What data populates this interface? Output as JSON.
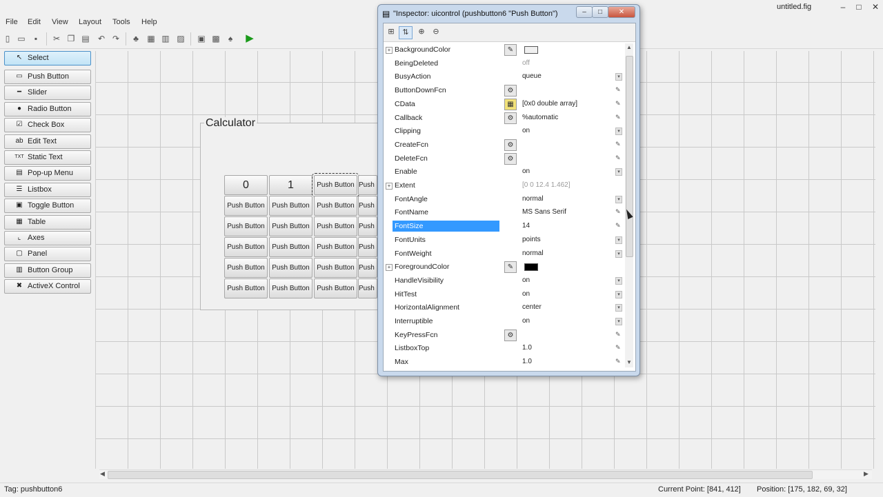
{
  "window": {
    "title": "untitled.fig",
    "controls": [
      "minimize-icon",
      "maximize-icon",
      "close-icon"
    ]
  },
  "menu": [
    "File",
    "Edit",
    "View",
    "Layout",
    "Tools",
    "Help"
  ],
  "palette": [
    {
      "label": "Select",
      "icon": "arrow-cursor-icon",
      "selected": true
    },
    {
      "label": "Push Button",
      "icon": "push-button-icon"
    },
    {
      "label": "Slider",
      "icon": "slider-icon"
    },
    {
      "label": "Radio Button",
      "icon": "radio-button-icon"
    },
    {
      "label": "Check Box",
      "icon": "check-box-icon"
    },
    {
      "label": "Edit Text",
      "icon": "edit-text-icon"
    },
    {
      "label": "Static Text",
      "icon": "static-text-icon"
    },
    {
      "label": "Pop-up Menu",
      "icon": "popup-menu-icon"
    },
    {
      "label": "Listbox",
      "icon": "listbox-icon"
    },
    {
      "label": "Toggle Button",
      "icon": "toggle-button-icon"
    },
    {
      "label": "Table",
      "icon": "table-icon"
    },
    {
      "label": "Axes",
      "icon": "axes-icon"
    },
    {
      "label": "Panel",
      "icon": "panel-icon"
    },
    {
      "label": "Button Group",
      "icon": "button-group-icon"
    },
    {
      "label": "ActiveX Control",
      "icon": "activex-icon"
    }
  ],
  "panel": {
    "title": "Calculator"
  },
  "buttons": {
    "row1": [
      "0",
      "1",
      "Push Button",
      "Push B"
    ],
    "default_label": "Push Button",
    "partial_label": "Push B"
  },
  "inspector": {
    "title": "\"Inspector:  uicontrol (pushbutton6 \"Push Button\")",
    "properties": [
      {
        "name": "BackgroundColor",
        "value": "",
        "expand": true,
        "editor": "color",
        "swatch": "#f0f0f0",
        "ctrl": "none"
      },
      {
        "name": "BeingDeleted",
        "value": "off",
        "disabled": true,
        "ctrl": "none"
      },
      {
        "name": "BusyAction",
        "value": "queue",
        "ctrl": "dropdown"
      },
      {
        "name": "ButtonDownFcn",
        "value": "",
        "editor": "callback",
        "ctrl": "pencil"
      },
      {
        "name": "CData",
        "value": "[0x0  double array]",
        "editor": "array",
        "ctrl": "pencil"
      },
      {
        "name": "Callback",
        "value": "%automatic",
        "editor": "callback",
        "ctrl": "pencil"
      },
      {
        "name": "Clipping",
        "value": "on",
        "ctrl": "dropdown"
      },
      {
        "name": "CreateFcn",
        "value": "",
        "editor": "callback",
        "ctrl": "pencil"
      },
      {
        "name": "DeleteFcn",
        "value": "",
        "editor": "callback",
        "ctrl": "pencil"
      },
      {
        "name": "Enable",
        "value": "on",
        "ctrl": "dropdown"
      },
      {
        "name": "Extent",
        "value": "[0 0 12.4 1.462]",
        "expand": true,
        "disabled": true,
        "ctrl": "none"
      },
      {
        "name": "FontAngle",
        "value": "normal",
        "ctrl": "dropdown"
      },
      {
        "name": "FontName",
        "value": "MS Sans Serif",
        "ctrl": "pencil"
      },
      {
        "name": "FontSize",
        "value": "14",
        "highlight": true,
        "ctrl": "pencil"
      },
      {
        "name": "FontUnits",
        "value": "points",
        "ctrl": "dropdown"
      },
      {
        "name": "FontWeight",
        "value": "normal",
        "ctrl": "dropdown"
      },
      {
        "name": "ForegroundColor",
        "value": "",
        "expand": true,
        "editor": "color",
        "swatch": "#000000",
        "ctrl": "none"
      },
      {
        "name": "HandleVisibility",
        "value": "on",
        "ctrl": "dropdown"
      },
      {
        "name": "HitTest",
        "value": "on",
        "ctrl": "dropdown"
      },
      {
        "name": "HorizontalAlignment",
        "value": "center",
        "ctrl": "dropdown"
      },
      {
        "name": "Interruptible",
        "value": "on",
        "ctrl": "dropdown"
      },
      {
        "name": "KeyPressFcn",
        "value": "",
        "editor": "callback",
        "ctrl": "pencil"
      },
      {
        "name": "ListboxTop",
        "value": "1.0",
        "ctrl": "pencil"
      },
      {
        "name": "Max",
        "value": "1.0",
        "ctrl": "pencil"
      }
    ]
  },
  "status": {
    "tag": "Tag: pushbutton6",
    "current_point": "Current Point:  [841, 412]",
    "position": "Position:  [175, 182, 69, 32]"
  }
}
